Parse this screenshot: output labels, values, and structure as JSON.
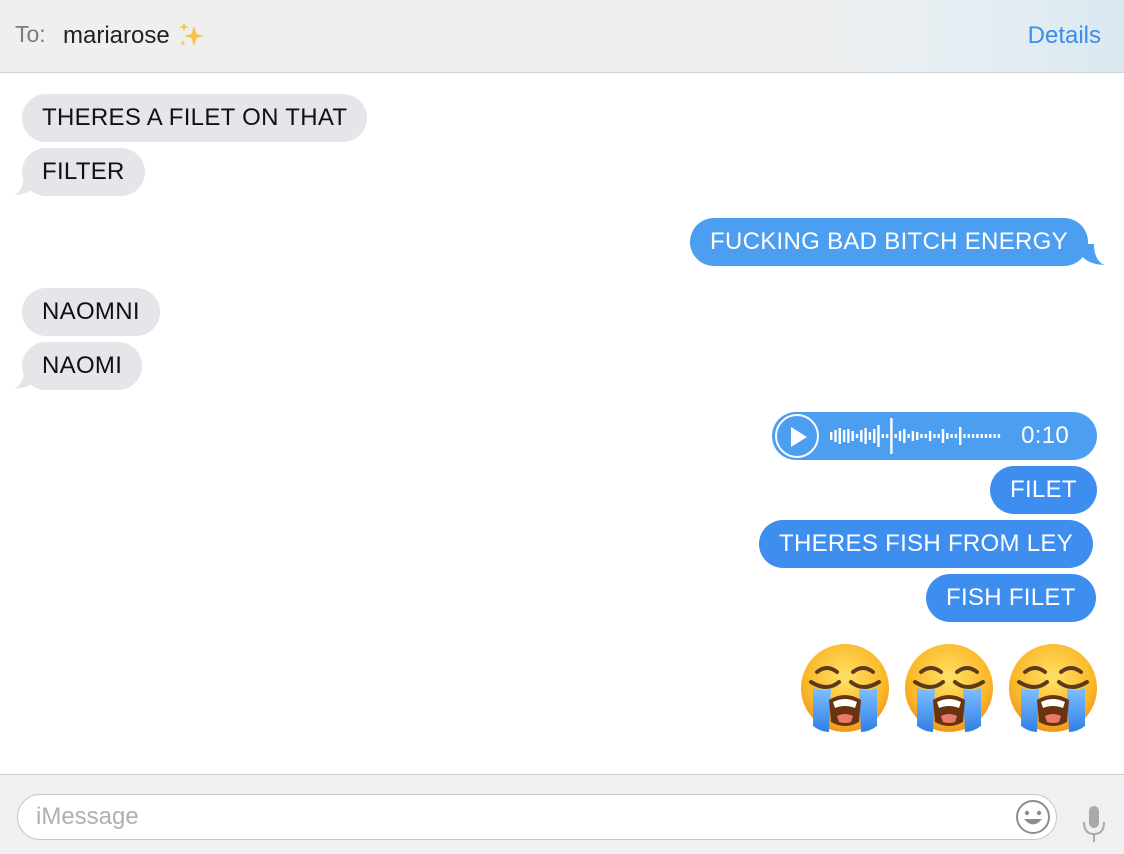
{
  "header": {
    "to_label": "To:",
    "recipient": "mariarose",
    "recipient_icon": "sparkles-icon",
    "details_label": "Details"
  },
  "messages": [
    {
      "direction": "incoming",
      "text": "THERES A FILET ON THAT"
    },
    {
      "direction": "incoming",
      "text": "FILTER"
    },
    {
      "direction": "outgoing",
      "text": "FUCKING BAD BITCH ENERGY"
    },
    {
      "direction": "incoming",
      "text": "NAOMNI"
    },
    {
      "direction": "incoming",
      "text": "NAOMI"
    },
    {
      "direction": "outgoing",
      "type": "audio",
      "duration": "0:10"
    },
    {
      "direction": "outgoing",
      "text": "FILET"
    },
    {
      "direction": "outgoing",
      "text": "THERES FISH FROM LEY"
    },
    {
      "direction": "outgoing",
      "text": "FISH FILET"
    },
    {
      "direction": "outgoing",
      "type": "emoji",
      "emoji": [
        "loudly-crying-face",
        "loudly-crying-face",
        "loudly-crying-face"
      ]
    }
  ],
  "composer": {
    "placeholder": "iMessage",
    "value": "",
    "emoji_button_icon": "smiley-icon",
    "mic_icon": "microphone-icon"
  },
  "colors": {
    "outgoing_bubble": "#4c9ff0",
    "incoming_bubble": "#e5e5ea",
    "accent": "#3b8df0"
  }
}
